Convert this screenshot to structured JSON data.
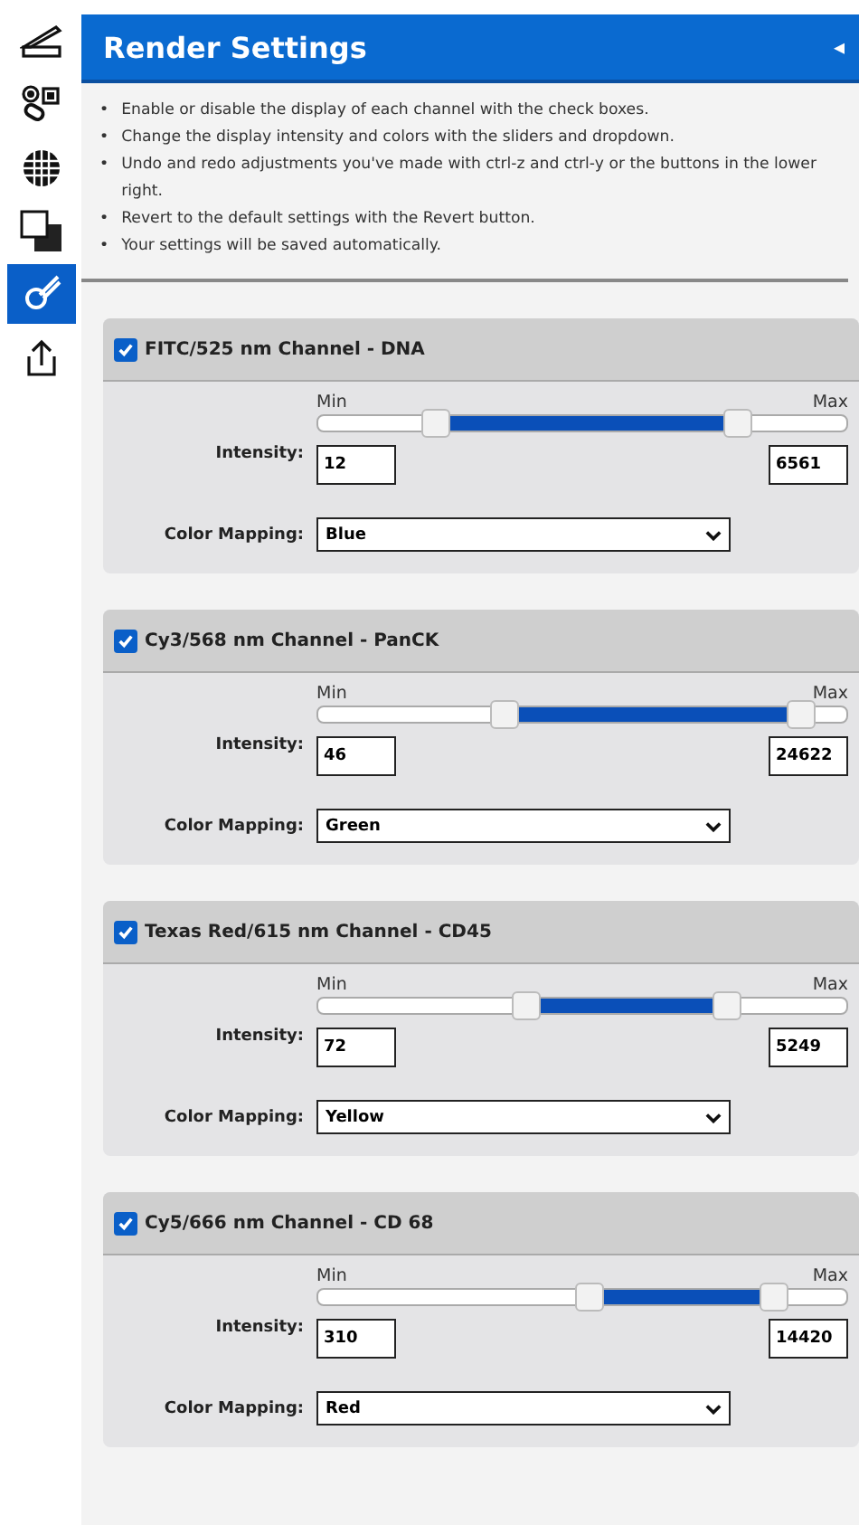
{
  "sidebar": {
    "items": [
      {
        "kind": "scanner",
        "selected": false
      },
      {
        "kind": "shapes",
        "selected": false
      },
      {
        "kind": "grid",
        "selected": false
      },
      {
        "kind": "layers",
        "selected": false
      },
      {
        "kind": "brush",
        "selected": true
      },
      {
        "kind": "share",
        "selected": false
      }
    ]
  },
  "panel": {
    "title": "Render Settings",
    "collapse": "◂"
  },
  "notes": [
    {
      "bullet": "•",
      "text": "Enable or disable the display of each channel with the check boxes."
    },
    {
      "bullet": "•",
      "text": "Change the display intensity and colors with the sliders and dropdown."
    },
    {
      "bullet": "•",
      "text": "Undo and redo adjustments you've made with ctrl-z and ctrl-y or the buttons in the lower right."
    },
    {
      "bullet": "•",
      "text": "Revert to the default settings with the Revert button."
    },
    {
      "bullet": "•",
      "text": "Your settings will be saved automatically."
    }
  ],
  "channels": [
    {
      "name": "FITC/525 nm Channel - DNA",
      "checked": true,
      "min_label": "Min",
      "max_label": "Max",
      "intensity_label": "Intensity:",
      "min_thumb": {
        "level": 0.22
      },
      "max_thumb": {
        "level": 0.79
      },
      "min_value": "12",
      "max_value": "6561",
      "mapping_label": "Color Mapping:",
      "mapping": "Blue"
    },
    {
      "name": "Cy3/568 nm Channel - PanCK",
      "checked": true,
      "min_label": "Min",
      "max_label": "Max",
      "intensity_label": "Intensity:",
      "min_thumb": {
        "level": 0.35
      },
      "max_thumb": {
        "level": 0.91
      },
      "min_value": "46",
      "max_value": "24622",
      "mapping_label": "Color Mapping:",
      "mapping": "Green"
    },
    {
      "name": "Texas Red/615 nm Channel - CD45",
      "checked": true,
      "min_label": "Min",
      "max_label": "Max",
      "intensity_label": "Intensity:",
      "min_thumb": {
        "level": 0.39
      },
      "max_thumb": {
        "level": 0.77
      },
      "min_value": "72",
      "max_value": "5249",
      "mapping_label": "Color Mapping:",
      "mapping": "Yellow"
    },
    {
      "name": "Cy5/666 nm Channel - CD 68",
      "checked": true,
      "min_label": "Min",
      "max_label": "Max",
      "intensity_label": "Intensity:",
      "min_thumb": {
        "level": 0.51
      },
      "max_thumb": {
        "level": 0.86
      },
      "min_value": "310",
      "max_value": "14420",
      "mapping_label": "Color Mapping:",
      "mapping": "Red"
    }
  ]
}
